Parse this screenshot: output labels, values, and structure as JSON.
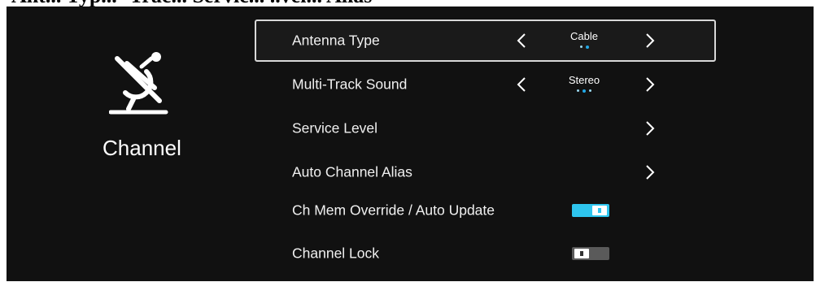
{
  "top_caption": "Ant... Typ... -Trac... Servic... ..vel... Alias",
  "sidebar": {
    "title": "Channel",
    "icon": "satellite-dish-off-icon"
  },
  "menu": {
    "items": [
      {
        "label": "Antenna Type",
        "value": "Cable",
        "kind": "selector",
        "selected": true,
        "option_count": 2,
        "option_index": 2
      },
      {
        "label": "Multi-Track Sound",
        "value": "Stereo",
        "kind": "selector",
        "selected": false,
        "option_count": 3,
        "option_index": 2
      },
      {
        "label": "Service Level",
        "kind": "submenu"
      },
      {
        "label": "Auto Channel Alias",
        "kind": "submenu"
      },
      {
        "label": "Ch Mem Override / Auto Update",
        "kind": "toggle",
        "on": true
      },
      {
        "label": "Channel Lock",
        "kind": "toggle",
        "on": false
      }
    ]
  },
  "colors": {
    "background": "#111111",
    "accent": "#2ec5ee",
    "text": "#f0f0f0",
    "selection_border": "#d8d8d8"
  }
}
